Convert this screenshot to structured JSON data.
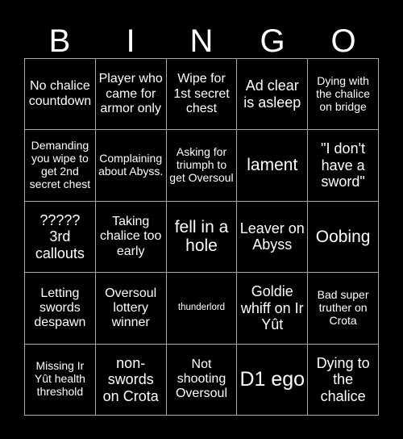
{
  "header": {
    "letters": [
      "B",
      "I",
      "N",
      "G",
      "O"
    ]
  },
  "colors": {
    "background": "#000000",
    "text": "#ffffff",
    "grid_line": "#a8a8a8"
  },
  "grid": {
    "rows": 5,
    "columns": 5,
    "cells": [
      {
        "text": "No chalice countdown",
        "size": "fs-m"
      },
      {
        "text": "Player who came for armor only",
        "size": "fs-m"
      },
      {
        "text": "Wipe for 1st secret chest",
        "size": "fs-m"
      },
      {
        "text": "Ad clear is asleep",
        "size": "fs-l"
      },
      {
        "text": "Dying with the chalice on bridge",
        "size": "fs-s"
      },
      {
        "text": "Demanding you wipe to get 2nd secret chest",
        "size": "fs-s"
      },
      {
        "text": "Complaining about Abyss.",
        "size": "fs-s"
      },
      {
        "text": "Asking for triumph to get Oversoul",
        "size": "fs-s"
      },
      {
        "text": "lament",
        "size": "fs-xl"
      },
      {
        "text": "\"I don't have a sword\"",
        "size": "fs-l"
      },
      {
        "text": "????? 3rd callouts",
        "size": "fs-l"
      },
      {
        "text": "Taking chalice too early",
        "size": "fs-m"
      },
      {
        "text": "fell in a hole",
        "size": "fs-xl"
      },
      {
        "text": "Leaver on Abyss",
        "size": "fs-l"
      },
      {
        "text": "Oobing",
        "size": "fs-xl"
      },
      {
        "text": "Letting swords despawn",
        "size": "fs-m"
      },
      {
        "text": "Oversoul lottery winner",
        "size": "fs-m"
      },
      {
        "text": "thunderlord",
        "size": "fs-xs"
      },
      {
        "text": "Goldie whiff on Ir Yût",
        "size": "fs-l"
      },
      {
        "text": "Bad super truther on Crota",
        "size": "fs-s"
      },
      {
        "text": "Missing Ir Yût health threshold",
        "size": "fs-s"
      },
      {
        "text": "non-swords on Crota",
        "size": "fs-l"
      },
      {
        "text": "Not shooting Oversoul",
        "size": "fs-m"
      },
      {
        "text": "D1 ego",
        "size": "fs-xxl"
      },
      {
        "text": "Dying to the chalice",
        "size": "fs-l"
      }
    ]
  }
}
